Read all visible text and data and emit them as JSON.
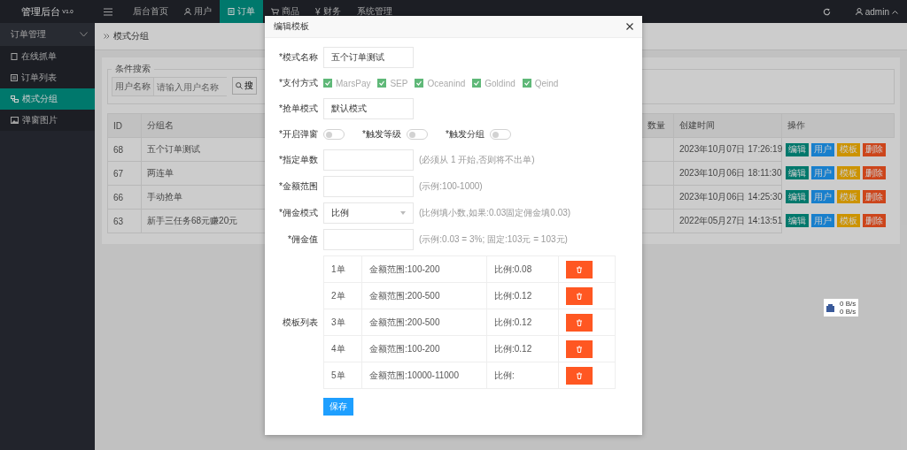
{
  "topbar": {
    "logo": "管理后台",
    "version": "V1.0",
    "nav": [
      {
        "label": "后台首页",
        "selected": false
      },
      {
        "label": "用户",
        "selected": false
      },
      {
        "label": "订单",
        "selected": true
      },
      {
        "label": "商品",
        "selected": false
      },
      {
        "label": "财务",
        "prefix": "¥",
        "selected": false
      },
      {
        "label": "系统管理",
        "selected": false
      }
    ],
    "user": "admin"
  },
  "sidebar": {
    "group": {
      "label": "订单管理",
      "expanded": true
    },
    "items": [
      {
        "label": "在线抓单",
        "selected": false
      },
      {
        "label": "订单列表",
        "selected": false
      },
      {
        "label": "模式分组",
        "selected": true
      },
      {
        "label": "弹窗图片",
        "selected": false
      }
    ]
  },
  "breadcrumb": "模式分组",
  "search": {
    "legend": "条件搜索",
    "field_label": "用户名称",
    "placeholder": "请输入用户名称",
    "button": "搜"
  },
  "table": {
    "columns": [
      "ID",
      "分组名",
      "数量",
      "创建时间",
      "操作"
    ],
    "rows": [
      {
        "id": "68",
        "name": "五个订单测试",
        "created": "2023年10月07日 17:26:19",
        "actions": [
          {
            "kind": "edit",
            "label": "编辑"
          },
          {
            "kind": "user",
            "label": "用户"
          },
          {
            "kind": "template",
            "label": "模板"
          },
          {
            "kind": "delete",
            "label": "删除"
          }
        ]
      },
      {
        "id": "67",
        "name": "两连单",
        "created": "2023年10月06日 18:11:30",
        "actions": [
          {
            "kind": "edit",
            "label": "编辑"
          },
          {
            "kind": "user",
            "label": "用户"
          },
          {
            "kind": "template",
            "label": "模板"
          },
          {
            "kind": "delete",
            "label": "删除"
          }
        ]
      },
      {
        "id": "66",
        "name": "手动抢单",
        "created": "2023年10月06日 14:25:30",
        "actions": [
          {
            "kind": "edit",
            "label": "编辑"
          },
          {
            "kind": "user",
            "label": "用户"
          },
          {
            "kind": "template",
            "label": "模板"
          },
          {
            "kind": "delete",
            "label": "删除"
          }
        ]
      },
      {
        "id": "63",
        "name": "新手三任务68元赚20元",
        "created": "2022年05月27日 14:13:51",
        "actions": [
          {
            "kind": "edit",
            "label": "编辑"
          },
          {
            "kind": "user",
            "label": "用户"
          },
          {
            "kind": "template",
            "label": "模板"
          },
          {
            "kind": "delete",
            "label": "删除"
          }
        ]
      }
    ]
  },
  "modal": {
    "title": "编辑模板",
    "fields": [
      {
        "kind": "text",
        "label": "*模式名称",
        "value": "五个订单测试"
      },
      {
        "kind": "checks",
        "label": "*支付方式",
        "options": [
          {
            "label": "MarsPay",
            "checked": true
          },
          {
            "label": "SEP",
            "checked": true
          },
          {
            "label": "Oceanind",
            "checked": true
          },
          {
            "label": "Goldind",
            "checked": true
          },
          {
            "label": "Qeind",
            "checked": true
          }
        ]
      },
      {
        "kind": "text",
        "label": "*抢单模式",
        "value": "默认模式"
      },
      {
        "kind": "toggles",
        "toggles": [
          {
            "label": "*开启弹窗",
            "on": false
          },
          {
            "label": "*触发等级",
            "on": false
          },
          {
            "label": "*触发分组",
            "on": false
          }
        ]
      },
      {
        "kind": "text",
        "label": "*指定单数",
        "hint": "(必须从 1 开始,否则将不出单)"
      },
      {
        "kind": "text",
        "label": "*金额范围",
        "hint": "(示例:100-1000)"
      },
      {
        "kind": "select",
        "label": "*佣金模式",
        "value": "比例",
        "hint": "(比例填小数,如果:0.03固定佣金填0.03)"
      },
      {
        "kind": "text",
        "label": "*佣金值",
        "hint": "(示例:0.03 = 3%; 固定:103元 = 103元)"
      },
      {
        "kind": "table",
        "label": "模板列表",
        "rows": [
          [
            "1单",
            "金额范围:100-200",
            "比例:0.08"
          ],
          [
            "2单",
            "金额范围:200-500",
            "比例:0.12"
          ],
          [
            "3单",
            "金额范围:200-500",
            "比例:0.12"
          ],
          [
            "4单",
            "金额范围:100-200",
            "比例:0.12"
          ],
          [
            "5单",
            "金额范围:10000-11000",
            "比例:"
          ]
        ]
      }
    ],
    "save": "保存"
  },
  "net_monitor": {
    "up": "0 B/s",
    "down": "0 B/s"
  }
}
